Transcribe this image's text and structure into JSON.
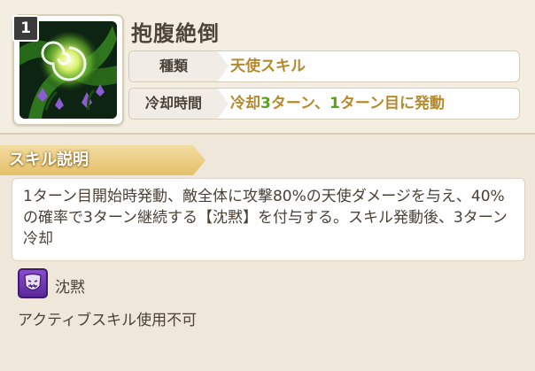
{
  "skill": {
    "level": "1",
    "name": "抱腹絶倒",
    "icon": "skill-art-green-swirl-icon"
  },
  "info": {
    "type_label": "種類",
    "type_value": "天使スキル",
    "cooldown_label": "冷却時間",
    "cooldown_parts": [
      "冷却",
      "3",
      "ターン、",
      "1",
      "ターン目に発動"
    ]
  },
  "description": {
    "header": "スキル説明",
    "text": "1ターン目開始時発動、敵全体に攻撃80%の天使ダメージを与え、40%の確率で3ターン継続する【沈黙】を付与する。スキル発動後、3ターン冷却"
  },
  "status": {
    "icon": "silence-mask-icon",
    "name": "沈黙",
    "effect": "アクティブスキル使用不可"
  },
  "colors": {
    "accent_gold": "#b48a2c",
    "accent_green": "#5aa21e",
    "header_gold": "#e6c06a",
    "silence_purple": "#7a3fc0"
  }
}
